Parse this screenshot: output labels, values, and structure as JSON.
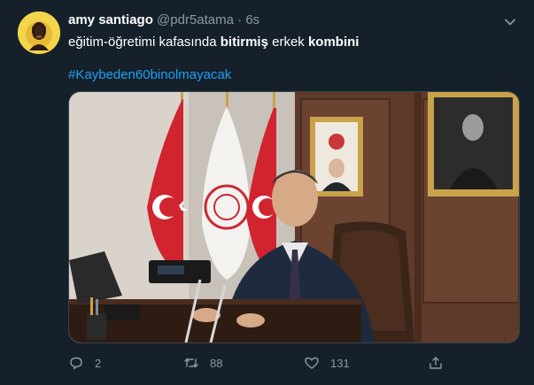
{
  "tweet": {
    "author_name": "amy santiago",
    "handle": "@pdr5atama",
    "separator": "·",
    "time": "6s",
    "text_parts": [
      "eğitim-öğretimi kafasında ",
      "bitirmiş",
      " erkek ",
      "kombini"
    ],
    "hashtag": "#Kaybeden60binolmayacak"
  },
  "icons": {
    "more": "chevron-down-icon",
    "reply": "reply-icon",
    "retweet": "retweet-icon",
    "like": "heart-icon",
    "share": "share-icon"
  },
  "actions": {
    "reply_count": "2",
    "retweet_count": "88",
    "like_count": "131"
  },
  "colors": {
    "background": "#15202b",
    "accent": "#1da1f2",
    "secondary_text": "#8899a6"
  }
}
